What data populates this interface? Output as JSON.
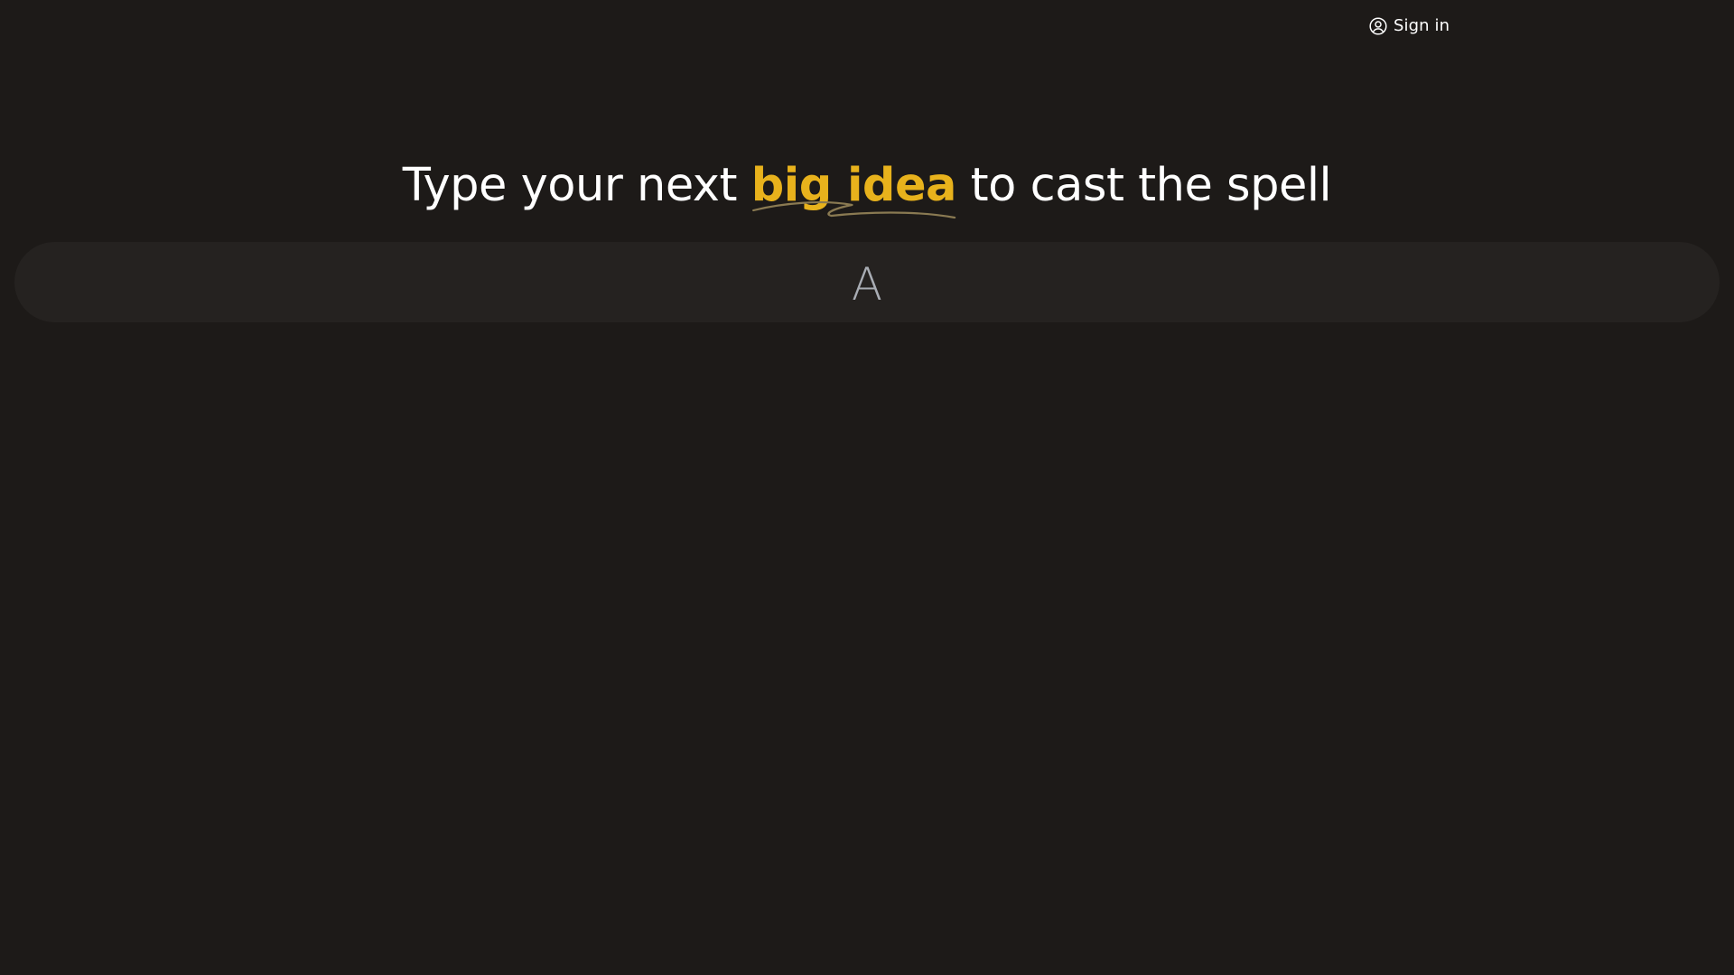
{
  "nav": {
    "sign_in_label": "Sign in",
    "sign_in_icon": "user-circle-icon"
  },
  "headline": {
    "prefix": "Type your next ",
    "highlight": "big idea",
    "suffix": " to cast the spell"
  },
  "idea_input": {
    "value": "",
    "placeholder": "A"
  },
  "colors": {
    "background": "#1d1a18",
    "input_background": "#252220",
    "accent": "#e8b21c",
    "underline": "#8a7a52",
    "placeholder": "#a9adb4"
  }
}
